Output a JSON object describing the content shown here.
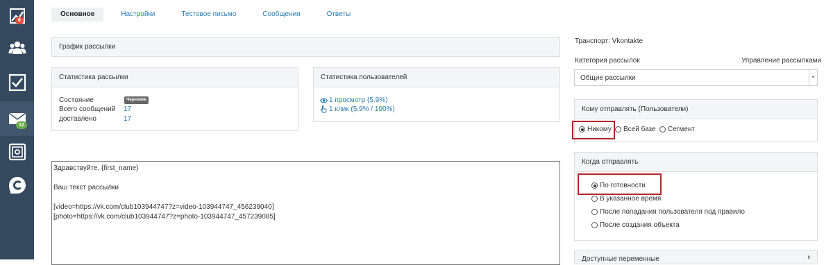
{
  "sidebar": {
    "items": [
      {
        "icon": "chart-icon",
        "badge": "6",
        "badge_color": "#e74c3c"
      },
      {
        "icon": "users-icon"
      },
      {
        "icon": "checkbox-icon"
      },
      {
        "icon": "mail-icon",
        "badge": "12",
        "badge_color": "#6aa84f"
      },
      {
        "icon": "safe-icon"
      },
      {
        "icon": "brand-c-icon"
      }
    ]
  },
  "tabs": [
    "Основное",
    "Настройки",
    "Тестовое письмо",
    "Сообщения",
    "Ответы"
  ],
  "schedule_panel": {
    "title": "График рассылки"
  },
  "mailing_stats": {
    "title": "Статистика рассылки",
    "state_label": "Состояние",
    "state_value": "Черновик",
    "total_label": "Всего сообщений",
    "total_value": "17",
    "delivered_label": "доставлено",
    "delivered_value": "17"
  },
  "user_stats": {
    "title": "Статистика пользователей",
    "views": "1 просмотр (5.9%)",
    "clicks": "1 клик (5.9% / 100%)"
  },
  "editor": {
    "lines": [
      "Здравствуйте, {first_name}",
      "",
      "Ваш текст рассылки",
      "",
      "[video=https://vk.com/club103944747?z=video-103944747_456239040]",
      "[photo=https://vk.com/club103944747?z=photo-103944747_457239085]"
    ]
  },
  "right": {
    "transport": "Транспорт: Vkontakte",
    "category_label": "Категория рассылок",
    "manage_link": "Управление рассылками",
    "category_value": "Общие рассылки",
    "recipients_title": "Кому отправлять (Пользователи)",
    "recipients_options": [
      "Никому",
      "Всей базе",
      "Сегмент"
    ],
    "when_title": "Когда отправлять",
    "when_options": [
      "По готовности",
      "В указанное время",
      "После попадания пользователя под правило",
      "После создания объекта"
    ],
    "available_vars": "Доступные переменные"
  }
}
